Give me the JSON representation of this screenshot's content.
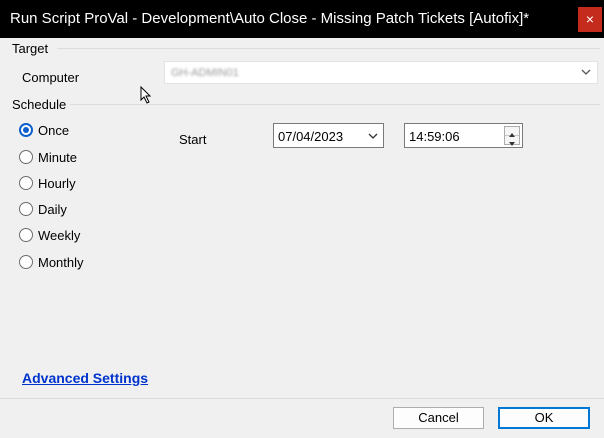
{
  "window": {
    "title": "Run Script ProVal - Development\\Auto Close - Missing Patch Tickets [Autofix]*",
    "close_glyph": "×"
  },
  "target": {
    "group_label": "Target",
    "computer_label": "Computer",
    "computer_value": "GH-ADMIN01"
  },
  "schedule": {
    "group_label": "Schedule",
    "options": [
      {
        "label": "Once",
        "checked": true
      },
      {
        "label": "Minute",
        "checked": false
      },
      {
        "label": "Hourly",
        "checked": false
      },
      {
        "label": "Daily",
        "checked": false
      },
      {
        "label": "Weekly",
        "checked": false
      },
      {
        "label": "Monthly",
        "checked": false
      }
    ],
    "start_label": "Start",
    "start_date": "07/04/2023",
    "start_time": "14:59:06"
  },
  "advanced_settings_label": "Advanced Settings",
  "buttons": {
    "cancel": "Cancel",
    "ok": "OK"
  }
}
